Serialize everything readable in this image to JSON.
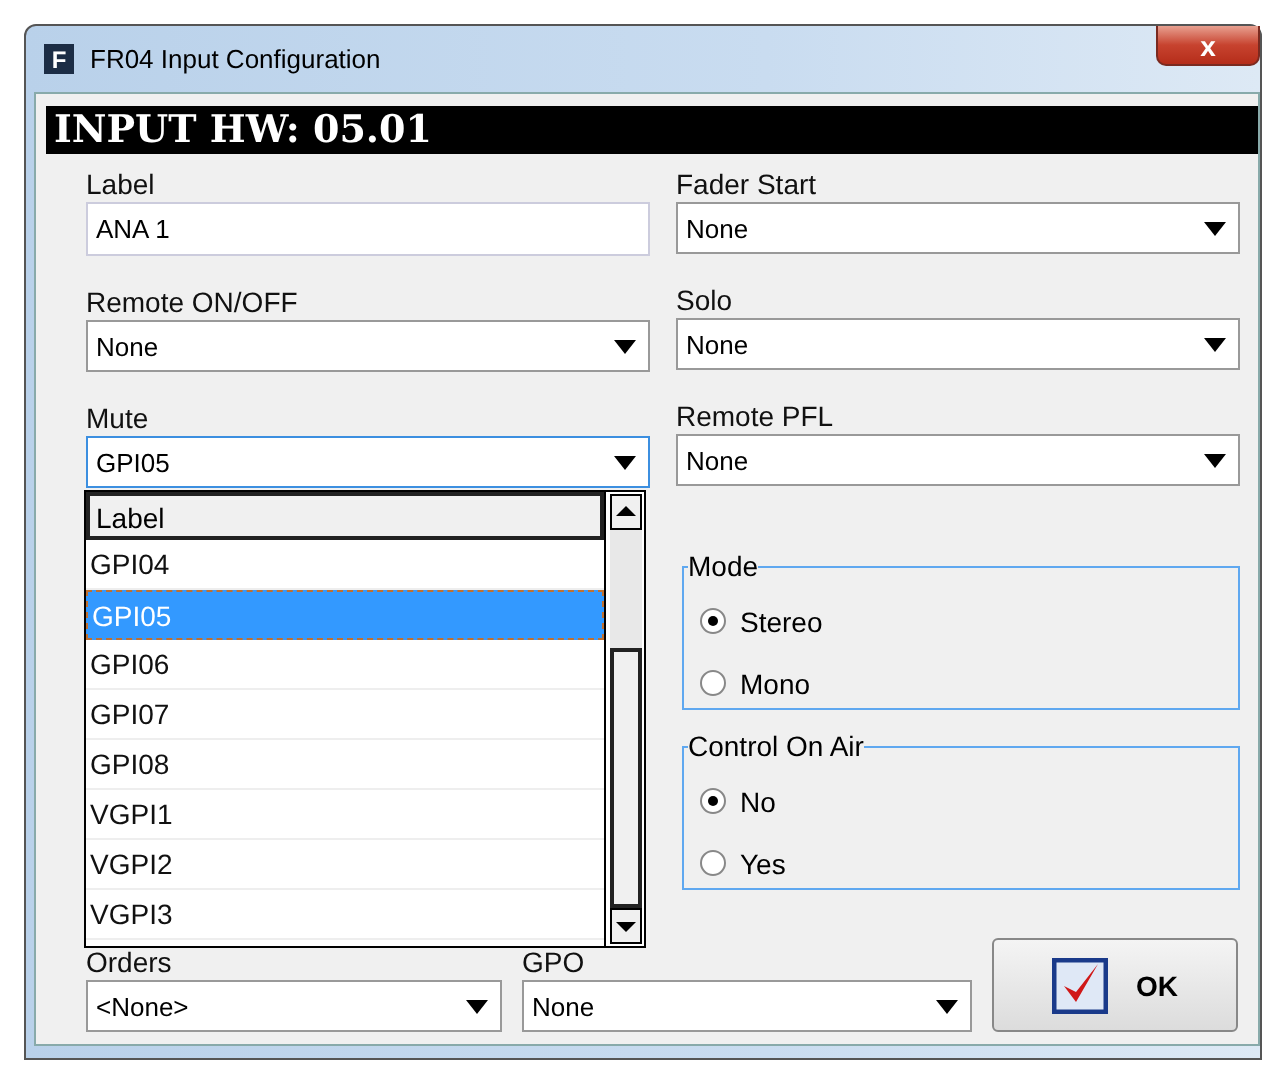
{
  "window": {
    "title": "FR04 Input Configuration",
    "app_icon": "F",
    "close": "x"
  },
  "header": "INPUT HW: 05.01",
  "label_field": {
    "label": "Label",
    "value": "ANA 1"
  },
  "left_selects": [
    {
      "label": "Remote ON/OFF",
      "value": "None"
    },
    {
      "label": "Mute",
      "value": "GPI05",
      "focused": true
    }
  ],
  "right_selects": [
    {
      "label": "Fader Start",
      "value": "None"
    },
    {
      "label": "Solo",
      "value": "None"
    },
    {
      "label": "Remote PFL",
      "value": "None"
    }
  ],
  "dropdown": {
    "column_header": "Label",
    "items": [
      {
        "text": "GPI04",
        "selected": false
      },
      {
        "text": "GPI05",
        "selected": true
      },
      {
        "text": "GPI06",
        "selected": false
      },
      {
        "text": "GPI07",
        "selected": false
      },
      {
        "text": "GPI08",
        "selected": false
      },
      {
        "text": "VGPI1",
        "selected": false
      },
      {
        "text": "VGPI2",
        "selected": false
      },
      {
        "text": "VGPI3",
        "selected": false
      }
    ]
  },
  "groups": [
    {
      "title": "Mode",
      "options": [
        {
          "label": "Stereo",
          "selected": true
        },
        {
          "label": "Mono",
          "selected": false
        }
      ]
    },
    {
      "title": "Control On Air",
      "options": [
        {
          "label": "No",
          "selected": true
        },
        {
          "label": "Yes",
          "selected": false
        }
      ]
    }
  ],
  "orders": {
    "label": "Orders",
    "value": "<None>"
  },
  "gpo": {
    "label": "GPO",
    "value": "None"
  },
  "ok_button": "OK"
}
